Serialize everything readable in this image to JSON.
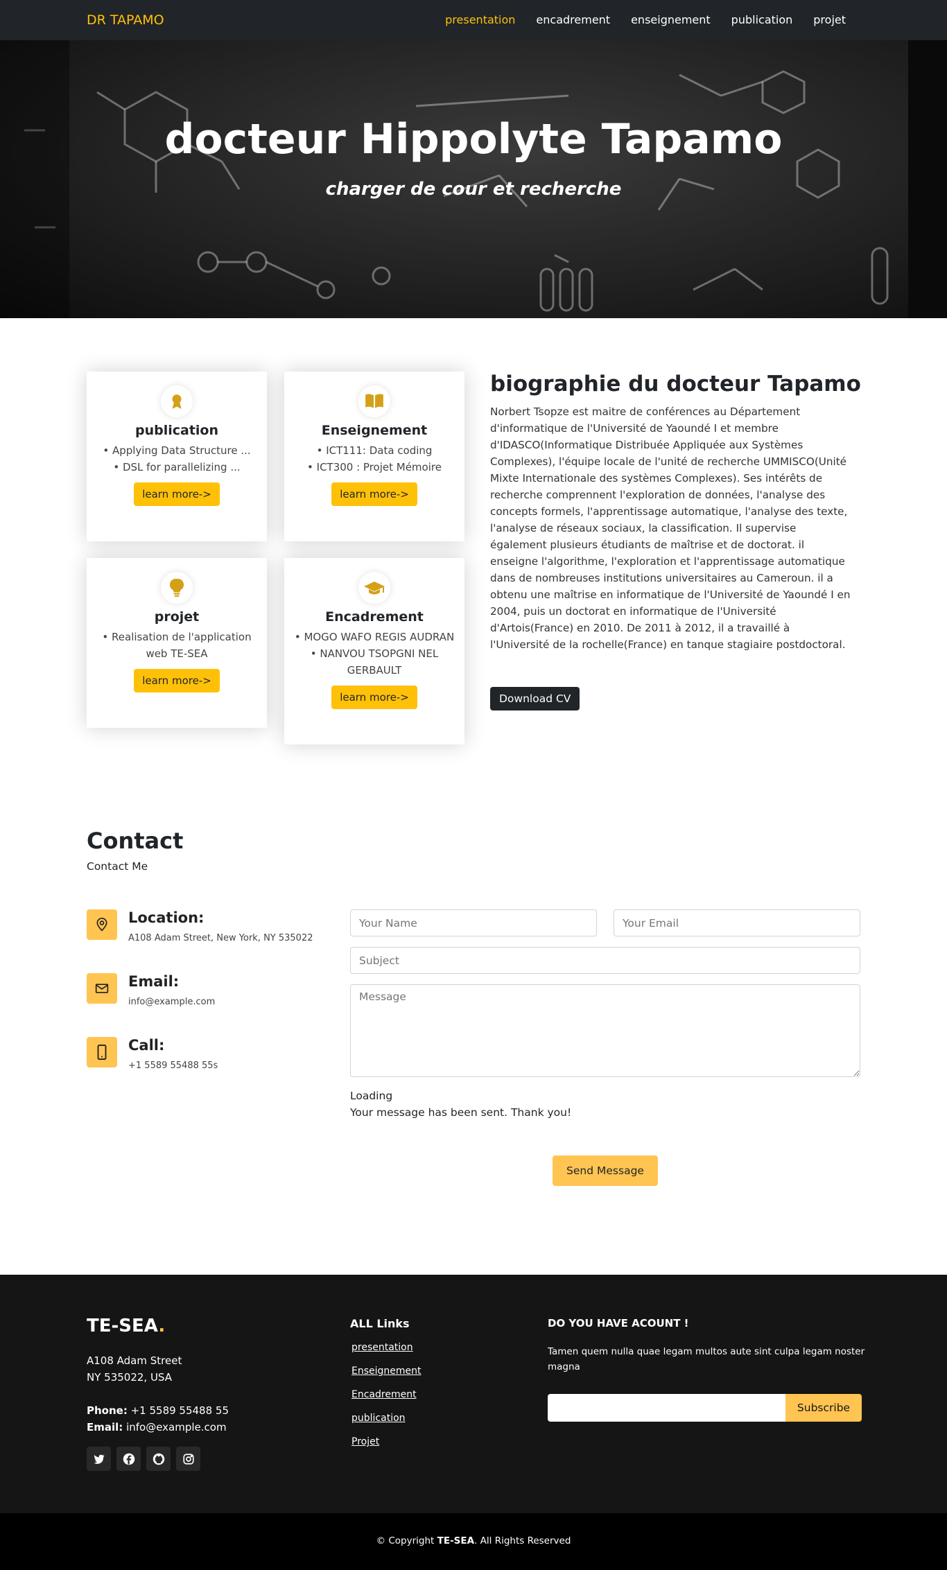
{
  "nav": {
    "brand": "DR TAPAMO",
    "items": [
      "presentation",
      "encadrement",
      "enseignement",
      "publication",
      "projet"
    ],
    "active_index": 0
  },
  "hero": {
    "title": "docteur Hippolyte Tapamo",
    "subtitle": "charger de cour et recherche"
  },
  "cards": [
    {
      "icon": "award-icon",
      "title": "publication",
      "items": [
        "Applying Data Structure ...",
        "DSL for parallelizing ..."
      ],
      "button": "learn more->"
    },
    {
      "icon": "book-icon",
      "title": "Enseignement",
      "items": [
        "ICT111: Data coding",
        "ICT300 : Projet Mémoire"
      ],
      "button": "learn more->"
    },
    {
      "icon": "lightbulb-icon",
      "title": "projet",
      "items": [
        "Realisation de l'application web TE-SEA"
      ],
      "button": "learn more->"
    },
    {
      "icon": "graduation-cap-icon",
      "title": "Encadrement",
      "items": [
        "MOGO WAFO REGIS AUDRAN",
        "NANVOU TSOPGNI NEL GERBAULT"
      ],
      "button": "learn more->"
    }
  ],
  "bio": {
    "title": "biographie du docteur Tapamo",
    "text": "Norbert Tsopze est maitre de conférences au Département d'informatique de l'Université de Yaoundé I et membre d'IDASCO(Informatique Distribuée Appliquée aux Systèmes Complexes), l'équipe locale de l'unité de recherche UMMISCO(Unité Mixte Internationale des systèmes Complexes). Ses intérêts de recherche comprennent l'exploration de données, l'analyse des concepts formels, l'apprentissage automatique, l'analyse des texte, l'analyse de réseaux sociaux, la classification. Il supervise également plusieurs étudiants de maîtrise et de doctorat. il enseigne l'algorithme, l'exploration et l'apprentissage automatique dans de nombreuses institutions universitaires au Cameroun. il a obtenu une maîtrise en informatique de l'Université de Yaoundé I en 2004, puis un doctorat en informatique de l'Université d'Artois(France) en 2010. De 2011 à 2012, il a travaillé à l'Université de la rochelle(France) en tanque stagiaire postdoctoral.",
    "cv_button": "Download CV"
  },
  "contact": {
    "title": "Contact",
    "subtitle": "Contact Me",
    "location_label": "Location:",
    "location_value": "A108 Adam Street, New York, NY 535022",
    "email_label": "Email:",
    "email_value": "info@example.com",
    "call_label": "Call:",
    "call_value": "+1 5589 55488 55s",
    "name_placeholder": "Your Name",
    "email_placeholder": "Your Email",
    "subject_placeholder": "Subject",
    "message_placeholder": "Message",
    "loading": "Loading",
    "sent": "Your message has been sent. Thank you!",
    "send_button": "Send Message"
  },
  "footer": {
    "brand": "TE-SEA",
    "brand_dot": ".",
    "addr1": "A108 Adam Street",
    "addr2": "NY 535022, USA",
    "phone_label": "Phone:",
    "phone_value": "+1 5589 55488 55",
    "email_label": "Email:",
    "email_value": "info@example.com",
    "links_title": "ALL Links",
    "links": [
      "presentation",
      "Enseignement",
      "Encadrement",
      "publication",
      "Projet"
    ],
    "newsletter_title": "DO YOU HAVE ACOUNT !",
    "newsletter_text": "Tamen quem nulla quae legam multos aute sint culpa legam noster magna",
    "subscribe": "Subscribe",
    "copy_pre": "© Copyright",
    "copy_brand": "TE-SEA",
    "copy_post": ". All Rights Reserved"
  },
  "colors": {
    "accent": "#ffc107",
    "accent_soft": "#ffc451",
    "dark": "#212529",
    "footer": "#151515"
  }
}
